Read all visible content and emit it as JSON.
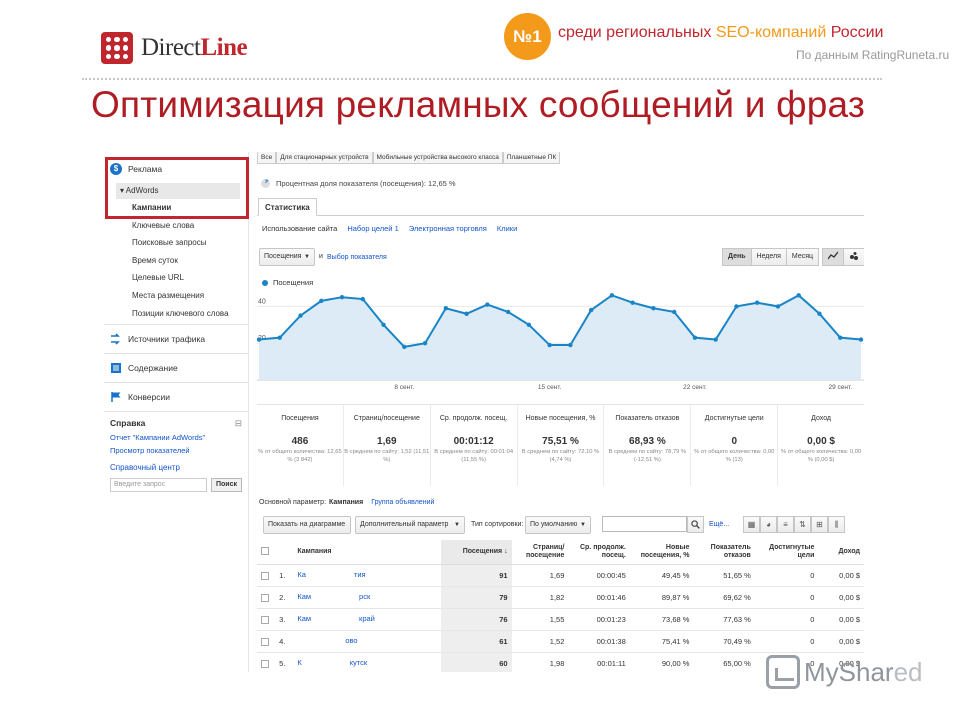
{
  "header": {
    "logo_prefix": "Direct",
    "logo_suffix": "Line",
    "badge": "№1",
    "rank_prefix": "среди региональных ",
    "rank_seo": "SEO-компаний",
    "rank_suffix": " России",
    "source": "По данным RatingRuneta.ru",
    "title": "Оптимизация рекламных сообщений и фраз"
  },
  "nav": {
    "ads": "Реклама",
    "adwords": "▾ AdWords",
    "items": [
      "Кампании",
      "Ключевые слова",
      "Поисковые запросы",
      "Время суток",
      "Целевые URL",
      "Места размещения",
      "Позиции ключевого слова"
    ],
    "traffic": "Источники трафика",
    "content": "Содержание",
    "conversions": "Конверсии",
    "help_title": "Справка",
    "help_collapse": "⊟",
    "help_links": [
      "Отчет \"Кампании AdWords\"",
      "Просмотр показателей"
    ],
    "help_center": "Справочный центр",
    "search_placeholder": "Введите запрос",
    "search_button": "Поиск"
  },
  "segments": [
    "Все",
    "Для стационарных устройств",
    "Мобильные устройства высокого класса",
    "Планшетные ПК"
  ],
  "share_text": "Процентная доля показателя (посещения): 12,65 %",
  "stat_tab": "Статистика",
  "sub_tabs": [
    "Использование сайта",
    "Набор целей 1",
    "Электронная торговля",
    "Клики"
  ],
  "controls": {
    "metric": "Посещения",
    "and": "и",
    "pick": "Выбор показателя",
    "periods": [
      "День",
      "Неделя",
      "Месяц"
    ],
    "period_selected": "День"
  },
  "chart_data": {
    "type": "line",
    "series": [
      {
        "name": "Посещения",
        "values": [
          22,
          23,
          35,
          43,
          45,
          44,
          30,
          18,
          20,
          39,
          36,
          41,
          37,
          30,
          19,
          19,
          38,
          46,
          42,
          39,
          37,
          23,
          22,
          40,
          42,
          40,
          46,
          36,
          23,
          22
        ]
      }
    ],
    "y_ticks": [
      20,
      40
    ],
    "ylim": [
      0,
      50
    ],
    "x_tick_labels": [
      "8 сент.",
      "15 сент.",
      "22 сент.",
      "29 сент."
    ],
    "x_tick_indices": [
      7,
      14,
      21,
      28
    ],
    "color": "#1a85c6",
    "fill": "#dcebf6"
  },
  "kpis": [
    {
      "label": "Посещения",
      "value": "486",
      "sub": "% от общего количества: 12,65 % (3 842)"
    },
    {
      "label": "Страниц/посещение",
      "value": "1,69",
      "sub": "В среднем по сайту: 1,52 (11,51 %)"
    },
    {
      "label": "Ср. продолж. посещ.",
      "value": "00:01:12",
      "sub": "В среднем по сайту: 00:01:04 (11,55 %)"
    },
    {
      "label": "Новые посещения, %",
      "value": "75,51 %",
      "sub": "В среднем по сайту: 72,10 % (4,74 %)"
    },
    {
      "label": "Показатель отказов",
      "value": "68,93 %",
      "sub": "В среднем по сайту: 78,79 % (-12,51 %)"
    },
    {
      "label": "Достигнутые цели",
      "value": "0",
      "sub": "% от общего количества: 0,00 % (13)"
    },
    {
      "label": "Доход",
      "value": "0,00 $",
      "sub": "% от общего количества: 0,00 % (0,00 $)"
    }
  ],
  "param": {
    "label": "Основной параметр:",
    "current": "Кампания",
    "other": "Группа объявлений"
  },
  "tools": {
    "show_on_chart": "Показать на диаграмме",
    "secondary": "Дополнительный параметр",
    "sort_label": "Тип сортировки:",
    "sort_value": "По умолчанию",
    "more": "Ещё..."
  },
  "table": {
    "headers": [
      "Кампания",
      "Посещения",
      "Страниц/ посещение",
      "Ср. продолж. посещ.",
      "Новые посещения, %",
      "Показатель отказов",
      "Достигнутые цели",
      "Доход"
    ],
    "rows": [
      {
        "n": "1.",
        "name_a": "Ка",
        "name_b": "тия",
        "visits": "91",
        "pages": "1,69",
        "dur": "00:00:45",
        "new": "49,45 %",
        "bounce": "51,65 %",
        "goals": "0",
        "rev": "0,00 $"
      },
      {
        "n": "2.",
        "name_a": "Кам",
        "name_b": "рск",
        "visits": "79",
        "pages": "1,82",
        "dur": "00:01:46",
        "new": "89,87 %",
        "bounce": "69,62 %",
        "goals": "0",
        "rev": "0,00 $"
      },
      {
        "n": "3.",
        "name_a": "Кам",
        "name_b": "край",
        "visits": "76",
        "pages": "1,55",
        "dur": "00:01:23",
        "new": "73,68 %",
        "bounce": "77,63 %",
        "goals": "0",
        "rev": "0,00 $"
      },
      {
        "n": "4.",
        "name_a": "",
        "name_b": "ово",
        "visits": "61",
        "pages": "1,52",
        "dur": "00:01:38",
        "new": "75,41 %",
        "bounce": "70,49 %",
        "goals": "0",
        "rev": "0,00 $"
      },
      {
        "n": "5.",
        "name_a": "К",
        "name_b": "кутск",
        "visits": "60",
        "pages": "1,98",
        "dur": "00:01:11",
        "new": "90,00 %",
        "bounce": "65,00 %",
        "goals": "0",
        "rev": "0,00 $"
      }
    ]
  },
  "watermark": {
    "my": "My",
    "shar": "Shar",
    "ed": "ed"
  }
}
